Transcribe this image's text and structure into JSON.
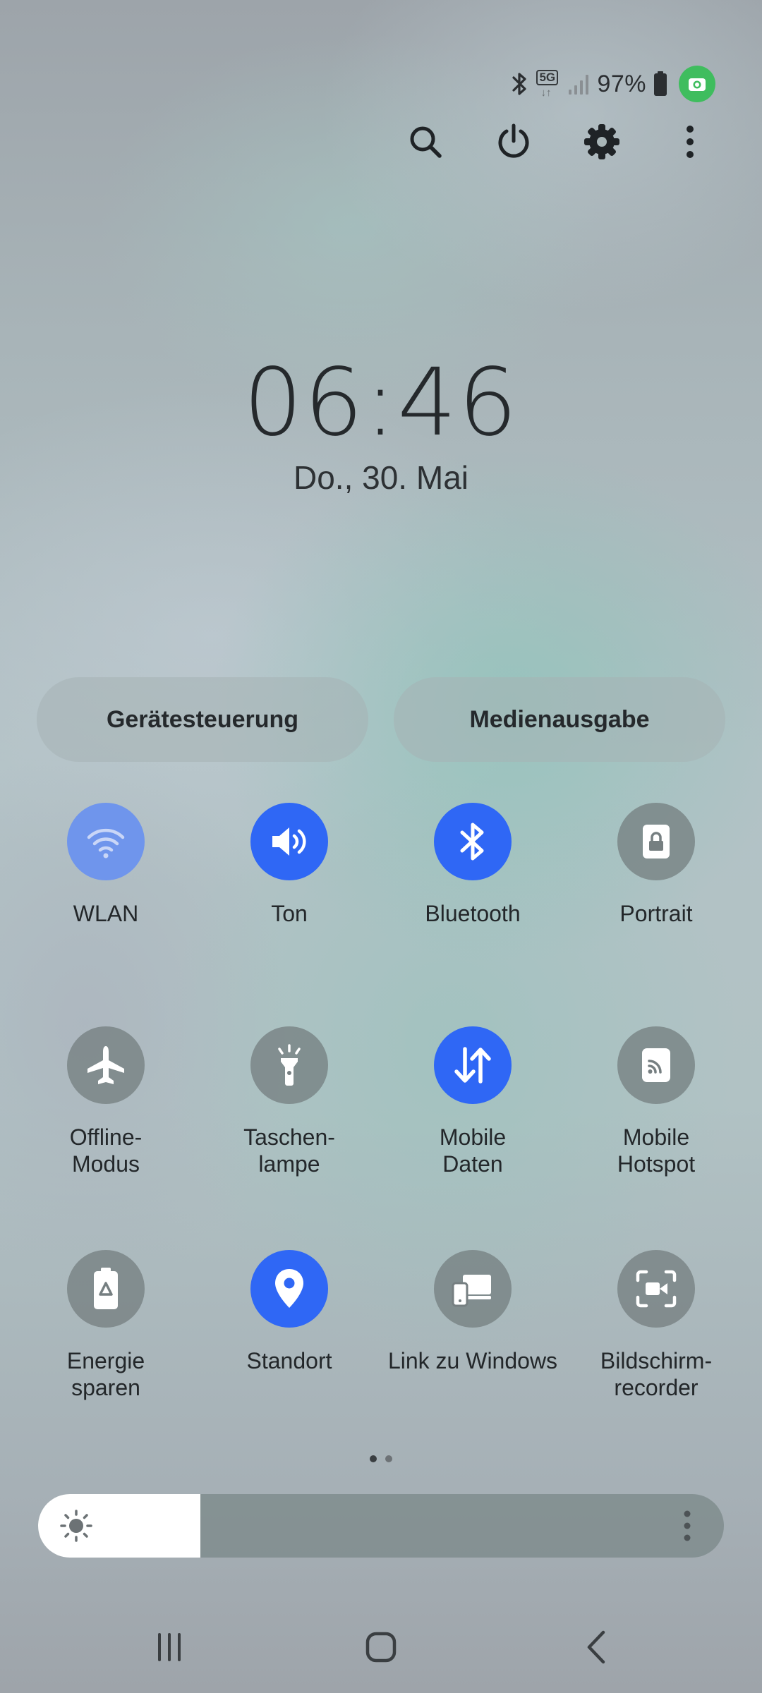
{
  "status_bar": {
    "bluetooth_icon": "bluetooth-icon",
    "network_label": "5G",
    "network_arrows": "↓↑",
    "signal_icon": "signal-bars-icon",
    "battery_percent": "97%",
    "battery_icon": "battery-icon",
    "camera_indicator_icon": "camera-icon",
    "camera_indicator_color": "#3fbd5e"
  },
  "top_actions": [
    {
      "name": "search",
      "icon": "search-icon"
    },
    {
      "name": "power",
      "icon": "power-icon"
    },
    {
      "name": "settings",
      "icon": "gear-icon"
    },
    {
      "name": "more",
      "icon": "more-vertical-icon"
    }
  ],
  "clock": {
    "time": "06:46",
    "date": "Do., 30. Mai"
  },
  "pills": {
    "device_control": "Gerätesteuerung",
    "media_output": "Medienausgabe"
  },
  "tiles": [
    {
      "label": "WLAN",
      "icon": "wifi-icon",
      "state": "partial"
    },
    {
      "label": "Ton",
      "icon": "speaker-icon",
      "state": "on"
    },
    {
      "label": "Bluetooth",
      "icon": "bluetooth-icon",
      "state": "on"
    },
    {
      "label": "Portrait",
      "icon": "rotation-lock-icon",
      "state": "off"
    },
    {
      "label": "Offline-\nModus",
      "icon": "airplane-icon",
      "state": "off"
    },
    {
      "label": "Taschen-\nlampe",
      "icon": "flashlight-icon",
      "state": "off"
    },
    {
      "label": "Mobile\nDaten",
      "icon": "mobile-data-icon",
      "state": "on"
    },
    {
      "label": "Mobile\nHotspot",
      "icon": "hotspot-icon",
      "state": "off"
    },
    {
      "label": "Energie\nsparen",
      "icon": "battery-saver-icon",
      "state": "off"
    },
    {
      "label": "Standort",
      "icon": "location-pin-icon",
      "state": "on"
    },
    {
      "label": "Link zu Windows",
      "icon": "link-to-windows-icon",
      "state": "off"
    },
    {
      "label": "Bildschirm-\nrecorder",
      "icon": "screen-recorder-icon",
      "state": "off"
    }
  ],
  "colors": {
    "accent_on": "#2f67f5",
    "accent_partial": "#6f95ec",
    "tile_off": "#767f81"
  },
  "pagination": {
    "pages": 2,
    "current": 1
  },
  "brightness": {
    "level": 0.237,
    "icon": "sun-icon",
    "more_icon": "more-vertical-icon"
  },
  "navbar": [
    {
      "name": "recents",
      "icon": "recents-icon"
    },
    {
      "name": "home",
      "icon": "home-icon"
    },
    {
      "name": "back",
      "icon": "back-icon"
    }
  ]
}
